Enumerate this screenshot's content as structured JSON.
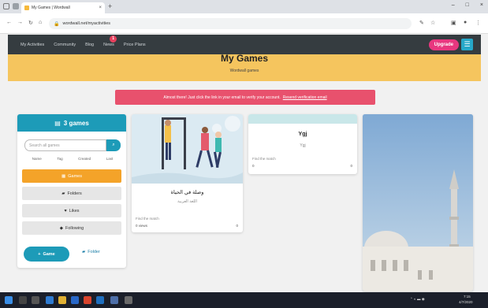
{
  "browser": {
    "tab_title": "My Games | Wordwall",
    "new_tab": "+",
    "tab_close": "×",
    "url": "wordwall.net/myactivities",
    "window_controls": [
      "–",
      "□",
      "×"
    ]
  },
  "navbar": {
    "links": [
      "My Activities",
      "Community",
      "Blog",
      "News",
      "Price Plans"
    ],
    "news_badge": "1",
    "upgrade": "Upgrade",
    "menu": "☰"
  },
  "header": {
    "title": "My Games",
    "subtitle": "Wordwall games"
  },
  "alert": {
    "text": "Almost there! Just click the link in your email to verify your account.",
    "link": "Resend verification email"
  },
  "sidebar": {
    "title": "3 games",
    "search_placeholder": "Search all games",
    "filters": [
      "Name",
      "Tag",
      "Created",
      "Last"
    ],
    "items": [
      {
        "label": "Games",
        "icon": "▦"
      },
      {
        "label": "Folders",
        "icon": "▰"
      },
      {
        "label": "Likes",
        "icon": "♥"
      },
      {
        "label": "Following",
        "icon": "◆"
      }
    ],
    "new_button": "Game",
    "folder_button": "Folder"
  },
  "cards": [
    {
      "title": "وصلة في الحياة",
      "subtitle": "اللغة العربية",
      "meta": "Find the match",
      "stat_left": "0 views",
      "stat_right": "0"
    },
    {
      "title": "Ygj",
      "subtitle": "Ygj",
      "meta": "Find the match",
      "stat_left": "0",
      "stat_right": "0"
    }
  ],
  "colors": {
    "nav_bg": "#353c40",
    "header_bg": "#f5c55e",
    "alert_bg": "#e8516d",
    "accent": "#1d9bb8",
    "active": "#f4a329",
    "upgrade": "#e8377f"
  },
  "taskbar": {
    "time": "7:15",
    "date": "4/7/2020"
  }
}
